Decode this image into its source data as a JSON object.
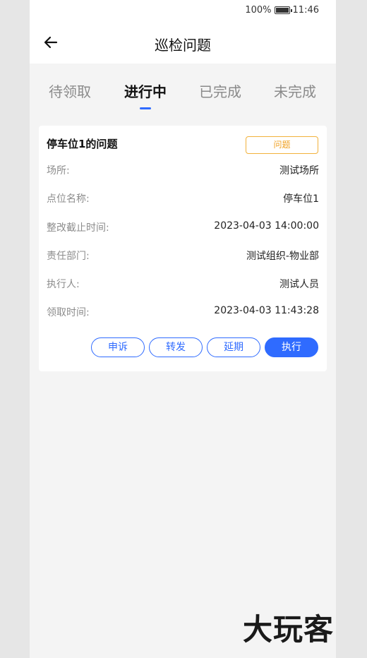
{
  "status_bar": {
    "battery_percent": "100%",
    "time": "11:46"
  },
  "header": {
    "title": "巡检问题"
  },
  "tabs": [
    {
      "label": "待领取"
    },
    {
      "label": "进行中",
      "active": true
    },
    {
      "label": "已完成"
    },
    {
      "label": "未完成"
    }
  ],
  "card": {
    "title": "停车位1的问题",
    "tag": "问题",
    "fields": [
      {
        "label": "场所:",
        "value": "测试场所"
      },
      {
        "label": "点位名称:",
        "value": "停车位1"
      },
      {
        "label": "整改截止时间:",
        "value": "2023-04-03 14:00:00"
      },
      {
        "label": "责任部门:",
        "value": "测试组织-物业部"
      },
      {
        "label": "执行人:",
        "value": "测试人员"
      },
      {
        "label": "领取时间:",
        "value": "2023-04-03 11:43:28"
      }
    ],
    "actions": {
      "appeal": "申诉",
      "forward": "转发",
      "extend": "延期",
      "execute": "执行"
    }
  },
  "watermark": "大玩客",
  "colors": {
    "accent": "#2f6bff",
    "tag": "#f0a020"
  }
}
